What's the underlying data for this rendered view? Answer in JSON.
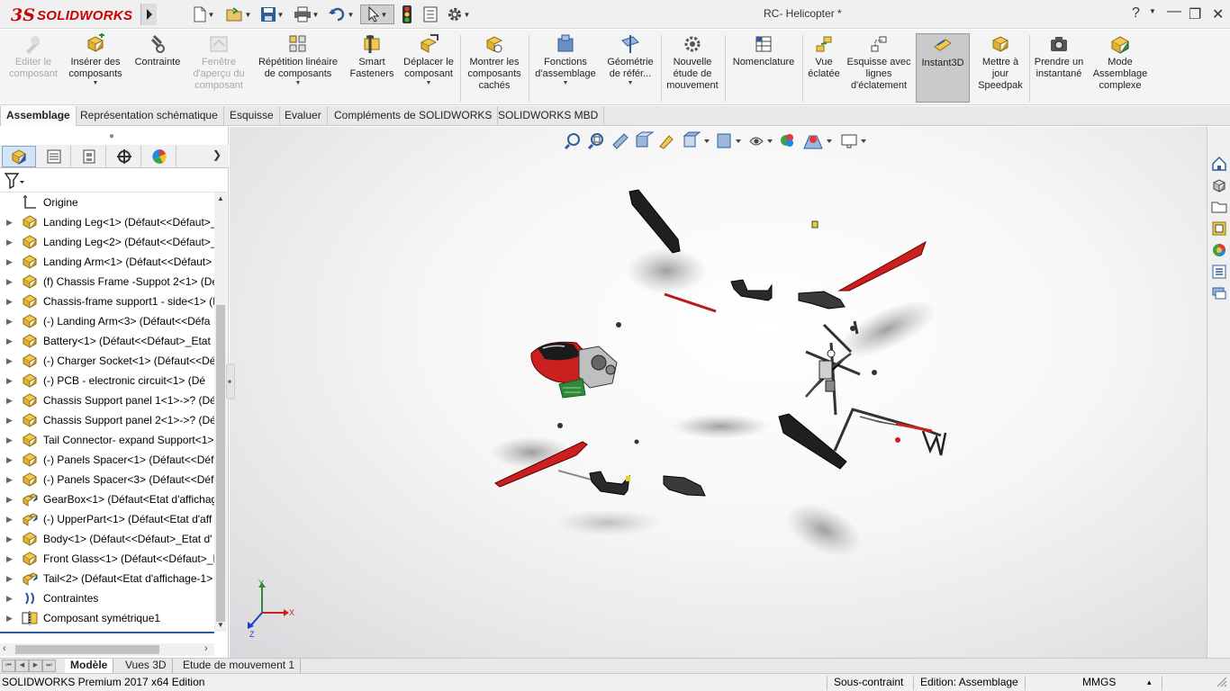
{
  "app": {
    "logo_ds": "3S",
    "logo_text": "SOLIDWORKS",
    "window_title": "RC- Helicopter *",
    "help": "?",
    "minimize": "—",
    "restore": "❐",
    "close": "✕"
  },
  "ribbon": [
    {
      "label": "Editer le composant",
      "icon": "edit-component-icon",
      "disabled": true
    },
    {
      "label": "Insérer des composants",
      "icon": "insert-components-icon"
    },
    {
      "label": "Contrainte",
      "icon": "mate-icon"
    },
    {
      "label": "Fenêtre d'aperçu du composant",
      "icon": "preview-window-icon",
      "disabled": true
    },
    {
      "label": "Répétition linéaire de composants",
      "icon": "linear-pattern-icon"
    },
    {
      "label": "Smart Fasteners",
      "icon": "smart-fasteners-icon"
    },
    {
      "label": "Déplacer le composant",
      "icon": "move-component-icon"
    },
    {
      "label": "Montrer les composants cachés",
      "icon": "show-hidden-icon"
    },
    {
      "label": "Fonctions d'assemblage",
      "icon": "assembly-features-icon"
    },
    {
      "label": "Géométrie de référ...",
      "icon": "reference-geometry-icon"
    },
    {
      "label": "Nouvelle étude de mouvement",
      "icon": "motion-study-icon"
    },
    {
      "label": "Nomenclature",
      "icon": "bom-icon"
    },
    {
      "label": "Vue éclatée",
      "icon": "exploded-view-icon"
    },
    {
      "label": "Esquisse avec lignes d'éclatement",
      "icon": "explode-line-sketch-icon"
    },
    {
      "label": "Instant3D",
      "icon": "instant3d-icon",
      "active": true
    },
    {
      "label": "Mettre à jour Speedpak",
      "icon": "speedpak-icon"
    },
    {
      "label": "Prendre un instantané",
      "icon": "snapshot-icon"
    },
    {
      "label": "Mode Assemblage complexe",
      "icon": "large-assembly-icon"
    }
  ],
  "tabs": [
    "Assemblage",
    "Représentation schématique",
    "Esquisse",
    "Evaluer",
    "Compléments de SOLIDWORKS",
    "SOLIDWORKS MBD"
  ],
  "tree": [
    {
      "label": "Origine",
      "icon": "origin-icon",
      "expand": false
    },
    {
      "label": "Landing Leg<1> (Défaut<<Défaut>_",
      "icon": "part-icon"
    },
    {
      "label": "Landing Leg<2> (Défaut<<Défaut>_",
      "icon": "part-icon"
    },
    {
      "label": "Landing Arm<1> (Défaut<<Défaut>",
      "icon": "part-icon"
    },
    {
      "label": "(f) Chassis Frame -Suppot 2<1> (Dé",
      "icon": "part-icon"
    },
    {
      "label": "Chassis-frame support1 - side<1> (I",
      "icon": "part-icon"
    },
    {
      "label": "(-) Landing Arm<3> (Défaut<<Défa",
      "icon": "part-icon"
    },
    {
      "label": "Battery<1> (Défaut<<Défaut>_Etat",
      "icon": "part-icon"
    },
    {
      "label": "(-) Charger Socket<1> (Défaut<<Dé",
      "icon": "part-icon"
    },
    {
      "label": "(-) PCB -  electronic circuit<1> (Dé",
      "icon": "part-icon"
    },
    {
      "label": "Chassis Support panel 1<1>->? (Déf",
      "icon": "part-icon"
    },
    {
      "label": "Chassis Support panel 2<1>->? (Déf",
      "icon": "part-icon"
    },
    {
      "label": "Tail Connector- expand Support<1>",
      "icon": "part-icon"
    },
    {
      "label": "(-) Panels Spacer<1> (Défaut<<Défa",
      "icon": "part-icon"
    },
    {
      "label": "(-) Panels Spacer<3> (Défaut<<Défa",
      "icon": "part-icon"
    },
    {
      "label": "GearBox<1> (Défaut<Etat d'affichag",
      "icon": "assembly-icon"
    },
    {
      "label": "(-) UpperPart<1> (Défaut<Etat d'aff",
      "icon": "assembly-icon"
    },
    {
      "label": "Body<1> (Défaut<<Défaut>_Etat d'",
      "icon": "part-icon"
    },
    {
      "label": "Front Glass<1> (Défaut<<Défaut>_E",
      "icon": "part-icon"
    },
    {
      "label": "Tail<2> (Défaut<Etat d'affichage-1>",
      "icon": "assembly-icon"
    },
    {
      "label": "Contraintes",
      "icon": "mates-folder-icon"
    },
    {
      "label": "Composant symétrique1",
      "icon": "mirror-component-icon"
    }
  ],
  "bottom_tabs": [
    "Modèle",
    "Vues 3D",
    "Etude de mouvement 1"
  ],
  "status": {
    "edition": "SOLIDWORKS Premium 2017 x64 Edition",
    "state": "Sous-contraint",
    "mode": "Edition: Assemblage",
    "units": "MMGS",
    "units_caret": "▴"
  },
  "triad": {
    "x": "X",
    "y": "Y",
    "z": "Z"
  },
  "colors": {
    "red": "#cc1f1f",
    "dark": "#2a2a2a",
    "accent": "#cc0000"
  }
}
